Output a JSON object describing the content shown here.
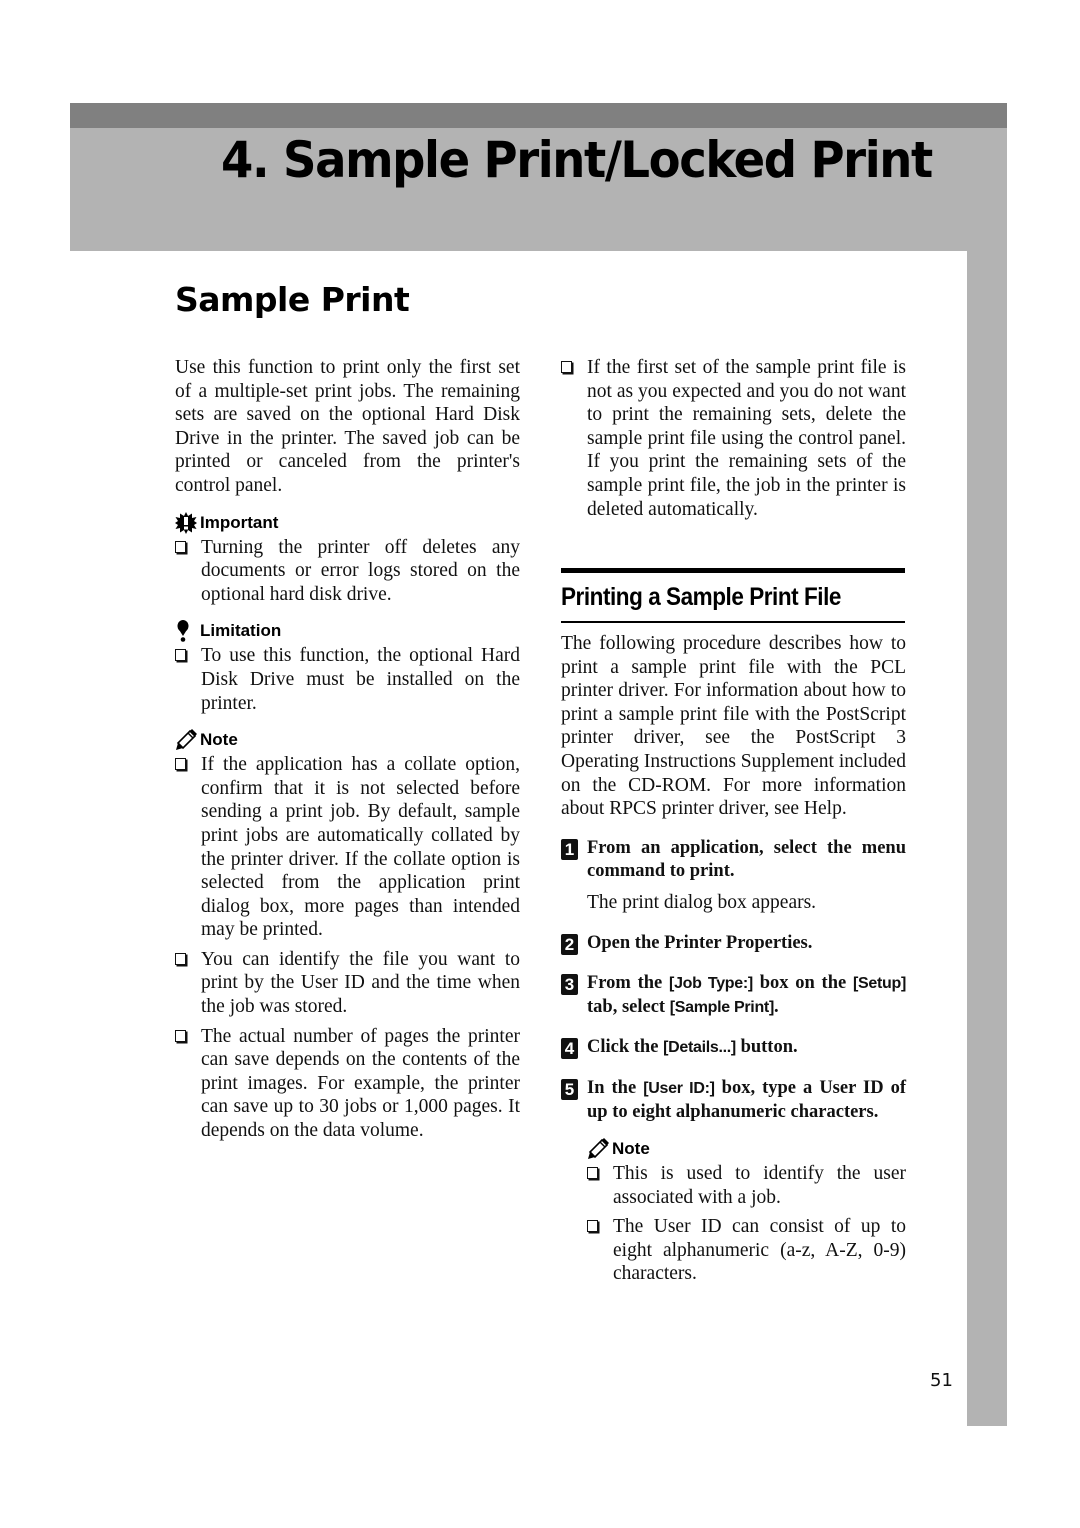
{
  "header": {
    "chapter_title": "4. Sample Print/Locked Print",
    "colors": {
      "dark_band": "#808080",
      "light_band": "#b3b3b3",
      "side_tab": "#b3b3b3"
    }
  },
  "section": {
    "title": "Sample Print"
  },
  "left": {
    "intro": "Use this function to print only the first set of a multiple-set print jobs. The remaining sets are saved on the optional Hard Disk Drive in the printer. The saved job can be printed or canceled from the printer's control panel.",
    "important": {
      "label": "Important",
      "icon": "important-icon",
      "items": [
        "Turning the printer off deletes any documents or error logs stored on the optional hard disk drive."
      ]
    },
    "limitation": {
      "label": "Limitation",
      "icon": "limitation-icon",
      "items": [
        "To use this function, the optional Hard Disk Drive must be installed on the printer."
      ]
    },
    "note": {
      "label": "Note",
      "icon": "pencil-note-icon",
      "items": [
        "If the application has a collate option, confirm that it is not selected before sending a print job. By default, sample print jobs are automatically collated by the printer driver. If the collate option is selected from the application print dialog box, more pages than intended may be printed.",
        "You can identify the file you want to print by the User ID and the time when the job was stored.",
        "The actual number of pages the printer can save depends on the contents of the print images. For example, the printer can save up to 30 jobs or 1,000 pages. It depends on the data volume."
      ]
    }
  },
  "right": {
    "top_items": [
      "If the first set of the sample print file is not as you expected and you do not want to print the remaining sets, delete the sample print file using the control panel. If you print the remaining sets of the sample print file, the job in the printer is deleted automatically."
    ],
    "subsection_title": "Printing a Sample Print File",
    "procedure_intro": "The following procedure describes how to print a sample print file with the PCL printer driver. For information about how to print a sample print file with the PostScript printer driver, see the PostScript 3 Operating Instructions Supplement included on the CD-ROM. For more information about RPCS printer driver, see Help.",
    "steps": [
      {
        "num": "1",
        "text": "From an application, select the menu command to print.",
        "result": "The print dialog box appears."
      },
      {
        "num": "2",
        "text": "Open the Printer Properties."
      },
      {
        "num": "3",
        "parts": [
          "From the ",
          "[Job Type:]",
          " box on the ",
          "[Setup]",
          " tab, select ",
          "[Sample Print]",
          "."
        ]
      },
      {
        "num": "4",
        "parts": [
          "Click the ",
          "[Details...]",
          " button."
        ]
      },
      {
        "num": "5",
        "parts": [
          "In the ",
          "[User ID:]",
          " box, type a User ID of up to eight alphanumeric characters."
        ]
      }
    ],
    "step5_note": {
      "label": "Note",
      "items": [
        "This is used to identify the user associated with a job.",
        "The User ID can consist of up to eight alphanumeric (a-z, A-Z, 0-9) characters."
      ]
    }
  },
  "footer": {
    "page_number": "51"
  }
}
